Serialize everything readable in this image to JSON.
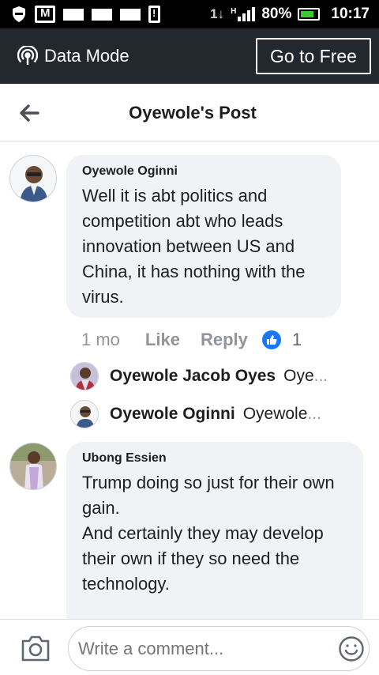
{
  "status_bar": {
    "network": "1↓",
    "signal": "H",
    "battery": "80%",
    "time": "10:17"
  },
  "data_bar": {
    "mode_label": "Data Mode",
    "go_free_label": "Go to Free"
  },
  "header": {
    "title": "Oyewole's Post"
  },
  "comments": [
    {
      "author": "Oyewole Oginni",
      "text": "Well it is abt politics and competition abt who leads innovation between US and China, it has nothing with the virus.",
      "time": "1 mo",
      "like_label": "Like",
      "reply_label": "Reply",
      "reaction_count": "1",
      "replies": [
        {
          "author": "Oyewole Jacob Oyes",
          "preview": "Oye",
          "ellipsis": "..."
        },
        {
          "author": "Oyewole Oginni",
          "preview": "Oyewole",
          "ellipsis": "..."
        }
      ]
    },
    {
      "author": "Ubong Essien",
      "text": "Trump doing so just for their own gain.\nAnd certainly they may develop their own if they so need the technology."
    }
  ],
  "composer": {
    "placeholder": "Write a comment..."
  },
  "colors": {
    "data_bar_bg": "#23272e",
    "bubble_bg": "#f0f2f5",
    "like_blue": "#1877f2",
    "meta_gray": "#90949c"
  }
}
